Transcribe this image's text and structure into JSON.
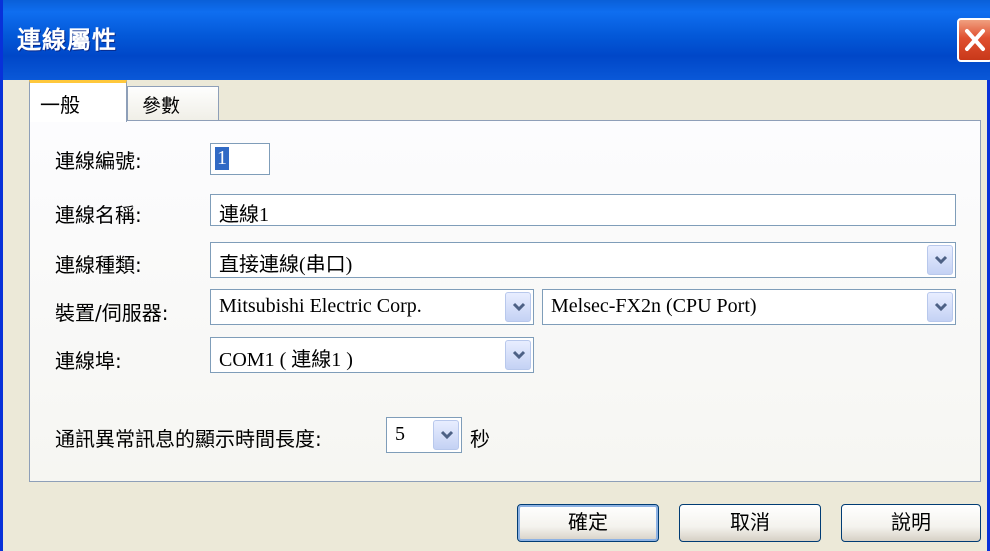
{
  "window": {
    "title": "連線屬性"
  },
  "tabs": [
    {
      "label": "一般",
      "selected": true
    },
    {
      "label": "參數",
      "selected": false
    }
  ],
  "form": {
    "connection_number": {
      "label": "連線編號:",
      "value": "1"
    },
    "connection_name": {
      "label": "連線名稱:",
      "value": "連線1"
    },
    "connection_type": {
      "label": "連線種類:",
      "value": "直接連線(串口)"
    },
    "device_server": {
      "label": "裝置/伺服器:",
      "manufacturer": "Mitsubishi Electric Corp.",
      "model": "Melsec-FX2n (CPU Port)"
    },
    "port": {
      "label": "連線埠:",
      "value": "COM1 ( 連線1 )"
    },
    "error_display": {
      "label": "通訊異常訊息的顯示時間長度:",
      "value": "5",
      "unit": "秒"
    }
  },
  "buttons": {
    "ok": "確定",
    "cancel": "取消",
    "help": "說明"
  },
  "colors": {
    "titlebar": "#0358d8",
    "window_bg": "#ece9d8",
    "tab_highlight": "#ffc83c",
    "close_button": "#e05030"
  }
}
